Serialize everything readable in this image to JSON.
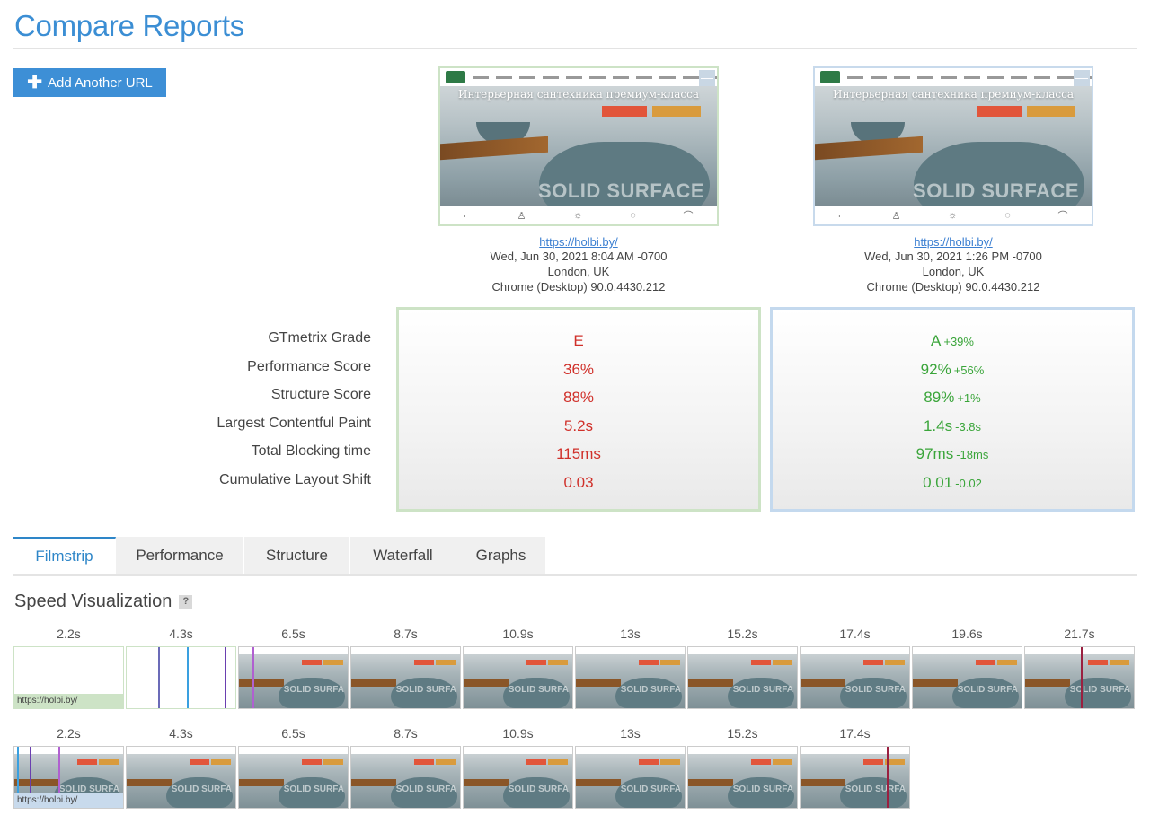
{
  "page_title": "Compare Reports",
  "add_button": {
    "label": "Add Another URL",
    "icon": "plus-icon"
  },
  "reports": [
    {
      "url": "https://holbi.by/",
      "date": "Wed, Jun 30, 2021 8:04 AM -0700",
      "location": "London, UK",
      "browser": "Chrome (Desktop) 90.0.4430.212",
      "thumb_hero": "Интерьерная сантехника премиум-класса",
      "thumb_watermark": "SOLID SURFACE",
      "border_color": "#cde3c6"
    },
    {
      "url": "https://holbi.by/",
      "date": "Wed, Jun 30, 2021 1:26 PM -0700",
      "location": "London, UK",
      "browser": "Chrome (Desktop) 90.0.4430.212",
      "thumb_hero": "Интерьерная сантехника премиум-класса",
      "thumb_watermark": "SOLID SURFACE",
      "border_color": "#c4d9ee"
    }
  ],
  "metric_labels": [
    "GTmetrix Grade",
    "Performance Score",
    "Structure Score",
    "Largest Contentful Paint",
    "Total Blocking time",
    "Cumulative Layout Shift"
  ],
  "scores_1": {
    "grade": "E",
    "performance": "36%",
    "structure": "88%",
    "lcp": "5.2s",
    "tbt": "115ms",
    "cls": "0.03",
    "color": "#d0302a"
  },
  "scores_2": {
    "grade": "A",
    "grade_diff": "+39%",
    "performance": "92%",
    "performance_diff": "+56%",
    "structure": "89%",
    "structure_diff": "+1%",
    "lcp": "1.4s",
    "lcp_diff": "-3.8s",
    "tbt": "97ms",
    "tbt_diff": "-18ms",
    "cls": "0.01",
    "cls_diff": "-0.02",
    "color": "#3aa53a"
  },
  "tabs": [
    "Filmstrip",
    "Performance",
    "Structure",
    "Waterfall",
    "Graphs"
  ],
  "active_tab": "Filmstrip",
  "section_title": "Speed Visualization",
  "help_icon_label": "?",
  "filmstrip_a": {
    "times": [
      "2.2s",
      "4.3s",
      "6.5s",
      "8.7s",
      "10.9s",
      "13s",
      "15.2s",
      "17.4s",
      "19.6s",
      "21.7s"
    ],
    "label": "https://holbi.by/"
  },
  "filmstrip_b": {
    "times": [
      "2.2s",
      "4.3s",
      "6.5s",
      "8.7s",
      "10.9s",
      "13s",
      "15.2s",
      "17.4s"
    ],
    "label": "https://holbi.by/"
  }
}
